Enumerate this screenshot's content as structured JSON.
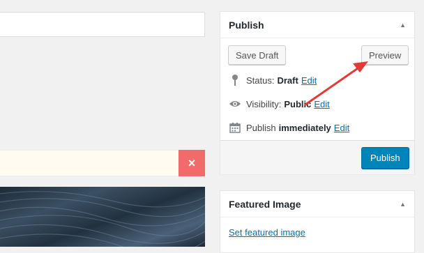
{
  "editor": {
    "notice_close_label": "×"
  },
  "publish_box": {
    "title": "Publish",
    "save_draft_label": "Save Draft",
    "preview_label": "Preview",
    "status_label": "Status:",
    "status_value": "Draft",
    "status_edit": "Edit",
    "visibility_label": "Visibility:",
    "visibility_value": "Public",
    "visibility_edit": "Edit",
    "schedule_label": "Publish",
    "schedule_value": "immediately",
    "schedule_edit": "Edit",
    "publish_label": "Publish"
  },
  "featured_box": {
    "title": "Featured Image",
    "set_link": "Set featured image"
  },
  "colors": {
    "accent_blue": "#0085ba",
    "link_blue": "#0073aa",
    "close_red": "#f26b6b",
    "annotation_arrow": "#e53935"
  },
  "icons": {
    "status": "pin-icon",
    "visibility": "eye-icon",
    "schedule": "calendar-icon",
    "collapse": "collapse-arrow-icon"
  }
}
